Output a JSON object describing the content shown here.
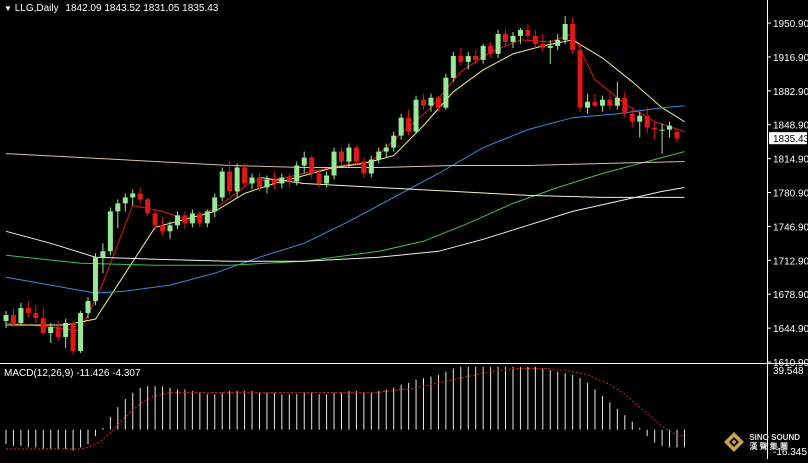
{
  "header": {
    "symbol_menu_glyph": "▼",
    "symbol": "LLG,Daily",
    "ohlc": "1842.09 1843.52 1831.05 1835.43"
  },
  "macd": {
    "label": "MACD(12,26,9) -11.426 -4.307",
    "axis_top": "39.548",
    "axis_bottom": "-16.345"
  },
  "price_axis": {
    "ticks": [
      "1950.90",
      "1916.90",
      "1882.90",
      "1848.90",
      "1814.90",
      "1780.90",
      "1746.90",
      "1712.90",
      "1678.90",
      "1644.90",
      "1610.90"
    ],
    "current_price": "1835.43"
  },
  "logo": {
    "line1": "SINO SOUND",
    "line2": "漢 聲 集 團",
    "icon": "sinosound-logo-icon"
  },
  "colors": {
    "background": "#000000",
    "bull_candle": "#98e898",
    "bear_candle": "#e01818",
    "ma_red": "#e01818",
    "ma_yellow": "#f0f080",
    "ma_blue": "#2f90e0",
    "ma_green": "#3cc04c",
    "ma_white": "#f0f0f0",
    "ma_tan": "#d8c0a0",
    "macd_hist": "#e8e8e8",
    "macd_signal": "#e02020",
    "axis_text": "#ffffff"
  },
  "chart_data": {
    "type": "candlestick",
    "ylim": [
      1610.9,
      1960.0
    ],
    "y_ticks": [
      1950.9,
      1916.9,
      1882.9,
      1848.9,
      1814.9,
      1780.9,
      1746.9,
      1712.9,
      1678.9,
      1644.9,
      1610.9
    ],
    "last_close": 1835.43,
    "candles": [
      [
        1652,
        1662,
        1645,
        1658
      ],
      [
        1658,
        1664,
        1646,
        1650
      ],
      [
        1650,
        1670,
        1648,
        1665
      ],
      [
        1665,
        1672,
        1656,
        1660
      ],
      [
        1660,
        1668,
        1650,
        1655
      ],
      [
        1655,
        1666,
        1638,
        1640
      ],
      [
        1640,
        1650,
        1630,
        1646
      ],
      [
        1646,
        1652,
        1632,
        1636
      ],
      [
        1636,
        1654,
        1625,
        1650
      ],
      [
        1650,
        1652,
        1618,
        1622
      ],
      [
        1622,
        1662,
        1620,
        1660
      ],
      [
        1660,
        1676,
        1655,
        1672
      ],
      [
        1672,
        1720,
        1668,
        1716
      ],
      [
        1716,
        1730,
        1700,
        1722
      ],
      [
        1722,
        1766,
        1718,
        1762
      ],
      [
        1762,
        1774,
        1745,
        1770
      ],
      [
        1770,
        1780,
        1762,
        1776
      ],
      [
        1776,
        1784,
        1768,
        1780
      ],
      [
        1780,
        1786,
        1770,
        1774
      ],
      [
        1774,
        1776,
        1757,
        1760
      ],
      [
        1760,
        1764,
        1744,
        1748
      ],
      [
        1748,
        1756,
        1738,
        1742
      ],
      [
        1742,
        1752,
        1734,
        1748
      ],
      [
        1748,
        1762,
        1744,
        1758
      ],
      [
        1758,
        1762,
        1744,
        1750
      ],
      [
        1750,
        1764,
        1746,
        1760
      ],
      [
        1760,
        1762,
        1746,
        1750
      ],
      [
        1750,
        1764,
        1746,
        1762
      ],
      [
        1762,
        1780,
        1756,
        1776
      ],
      [
        1776,
        1806,
        1772,
        1802
      ],
      [
        1802,
        1812,
        1778,
        1782
      ],
      [
        1782,
        1810,
        1776,
        1806
      ],
      [
        1806,
        1810,
        1786,
        1790
      ],
      [
        1790,
        1800,
        1784,
        1796
      ],
      [
        1796,
        1800,
        1782,
        1786
      ],
      [
        1786,
        1798,
        1780,
        1794
      ],
      [
        1794,
        1802,
        1784,
        1790
      ],
      [
        1790,
        1800,
        1785,
        1796
      ],
      [
        1796,
        1800,
        1786,
        1792
      ],
      [
        1792,
        1812,
        1788,
        1808
      ],
      [
        1808,
        1822,
        1800,
        1816
      ],
      [
        1816,
        1818,
        1795,
        1800
      ],
      [
        1800,
        1804,
        1786,
        1790
      ],
      [
        1790,
        1802,
        1786,
        1798
      ],
      [
        1798,
        1826,
        1794,
        1822
      ],
      [
        1822,
        1826,
        1808,
        1812
      ],
      [
        1812,
        1830,
        1806,
        1826
      ],
      [
        1826,
        1828,
        1808,
        1812
      ],
      [
        1812,
        1816,
        1796,
        1800
      ],
      [
        1800,
        1818,
        1796,
        1814
      ],
      [
        1814,
        1826,
        1810,
        1822
      ],
      [
        1822,
        1830,
        1816,
        1826
      ],
      [
        1826,
        1842,
        1822,
        1838
      ],
      [
        1838,
        1860,
        1834,
        1856
      ],
      [
        1856,
        1864,
        1838,
        1842
      ],
      [
        1842,
        1878,
        1840,
        1874
      ],
      [
        1874,
        1880,
        1864,
        1868
      ],
      [
        1868,
        1880,
        1862,
        1876
      ],
      [
        1876,
        1878,
        1862,
        1866
      ],
      [
        1866,
        1900,
        1864,
        1896
      ],
      [
        1896,
        1922,
        1892,
        1918
      ],
      [
        1918,
        1926,
        1908,
        1912
      ],
      [
        1912,
        1922,
        1904,
        1918
      ],
      [
        1918,
        1924,
        1910,
        1914
      ],
      [
        1914,
        1930,
        1910,
        1928
      ],
      [
        1928,
        1932,
        1916,
        1920
      ],
      [
        1920,
        1944,
        1916,
        1940
      ],
      [
        1940,
        1944,
        1928,
        1932
      ],
      [
        1932,
        1942,
        1926,
        1938
      ],
      [
        1938,
        1946,
        1930,
        1944
      ],
      [
        1944,
        1950,
        1934,
        1938
      ],
      [
        1938,
        1944,
        1926,
        1930
      ],
      [
        1930,
        1940,
        1922,
        1926
      ],
      [
        1926,
        1934,
        1910,
        1928
      ],
      [
        1928,
        1940,
        1924,
        1934
      ],
      [
        1934,
        1958,
        1930,
        1950
      ],
      [
        1950,
        1956,
        1920,
        1924
      ],
      [
        1924,
        1930,
        1862,
        1866
      ],
      [
        1866,
        1880,
        1860,
        1872
      ],
      [
        1872,
        1880,
        1866,
        1868
      ],
      [
        1868,
        1878,
        1862,
        1874
      ],
      [
        1874,
        1880,
        1864,
        1868
      ],
      [
        1868,
        1892,
        1864,
        1876
      ],
      [
        1876,
        1882,
        1856,
        1860
      ],
      [
        1860,
        1866,
        1846,
        1852
      ],
      [
        1852,
        1862,
        1836,
        1858
      ],
      [
        1858,
        1866,
        1840,
        1846
      ],
      [
        1846,
        1852,
        1834,
        1844
      ],
      [
        1844,
        1850,
        1820,
        1844
      ],
      [
        1844,
        1852,
        1836,
        1848
      ],
      [
        1842,
        1844,
        1831,
        1835
      ]
    ],
    "series": [
      {
        "name": "",
        "color": "#e01818",
        "values": [
          [
            0,
            1650
          ],
          [
            6,
            1646
          ],
          [
            10,
            1642
          ],
          [
            13,
            1690
          ],
          [
            17,
            1768
          ],
          [
            21,
            1762
          ],
          [
            25,
            1752
          ],
          [
            29,
            1770
          ],
          [
            33,
            1792
          ],
          [
            37,
            1795
          ],
          [
            41,
            1802
          ],
          [
            45,
            1808
          ],
          [
            49,
            1812
          ],
          [
            53,
            1840
          ],
          [
            57,
            1866
          ],
          [
            61,
            1902
          ],
          [
            65,
            1922
          ],
          [
            69,
            1934
          ],
          [
            73,
            1932
          ],
          [
            76,
            1940
          ],
          [
            79,
            1894
          ],
          [
            83,
            1870
          ],
          [
            87,
            1852
          ],
          [
            91,
            1842
          ]
        ]
      },
      {
        "name": "",
        "color": "#f0f080",
        "values": [
          [
            0,
            1648
          ],
          [
            8,
            1648
          ],
          [
            12,
            1654
          ],
          [
            16,
            1700
          ],
          [
            20,
            1746
          ],
          [
            24,
            1754
          ],
          [
            28,
            1762
          ],
          [
            32,
            1780
          ],
          [
            36,
            1790
          ],
          [
            40,
            1798
          ],
          [
            44,
            1806
          ],
          [
            48,
            1810
          ],
          [
            52,
            1818
          ],
          [
            56,
            1848
          ],
          [
            60,
            1882
          ],
          [
            64,
            1904
          ],
          [
            68,
            1920
          ],
          [
            72,
            1928
          ],
          [
            76,
            1934
          ],
          [
            80,
            1916
          ],
          [
            84,
            1892
          ],
          [
            88,
            1866
          ],
          [
            91,
            1852
          ]
        ]
      },
      {
        "name": "",
        "color": "#2f90e0",
        "values": [
          [
            0,
            1696
          ],
          [
            6,
            1688
          ],
          [
            12,
            1680
          ],
          [
            16,
            1682
          ],
          [
            22,
            1688
          ],
          [
            28,
            1700
          ],
          [
            34,
            1716
          ],
          [
            40,
            1730
          ],
          [
            46,
            1752
          ],
          [
            52,
            1776
          ],
          [
            58,
            1800
          ],
          [
            64,
            1826
          ],
          [
            70,
            1844
          ],
          [
            76,
            1856
          ],
          [
            82,
            1860
          ],
          [
            88,
            1866
          ],
          [
            91,
            1868
          ]
        ]
      },
      {
        "name": "",
        "color": "#3cc04c",
        "values": [
          [
            0,
            1718
          ],
          [
            10,
            1710
          ],
          [
            20,
            1708
          ],
          [
            30,
            1708
          ],
          [
            40,
            1712
          ],
          [
            50,
            1722
          ],
          [
            56,
            1732
          ],
          [
            62,
            1750
          ],
          [
            68,
            1770
          ],
          [
            74,
            1786
          ],
          [
            80,
            1800
          ],
          [
            86,
            1812
          ],
          [
            91,
            1822
          ]
        ]
      },
      {
        "name": "",
        "color": "#f0f0f0",
        "values": [
          [
            0,
            1742
          ],
          [
            6,
            1730
          ],
          [
            12,
            1716
          ],
          [
            20,
            1714
          ],
          [
            30,
            1712
          ],
          [
            40,
            1712
          ],
          [
            50,
            1716
          ],
          [
            58,
            1722
          ],
          [
            64,
            1734
          ],
          [
            70,
            1748
          ],
          [
            76,
            1762
          ],
          [
            82,
            1772
          ],
          [
            88,
            1782
          ],
          [
            91,
            1786
          ]
        ]
      },
      {
        "name": "",
        "color": "#d8c0a0",
        "values": [
          [
            0,
            1820
          ],
          [
            10,
            1816
          ],
          [
            20,
            1812
          ],
          [
            30,
            1808
          ],
          [
            40,
            1806
          ],
          [
            50,
            1806
          ],
          [
            60,
            1808
          ],
          [
            70,
            1808
          ],
          [
            80,
            1810
          ],
          [
            91,
            1812
          ]
        ]
      },
      {
        "name": "",
        "color": "#f0f0c8",
        "values": [
          [
            34,
            1796
          ],
          [
            40,
            1790
          ],
          [
            50,
            1786
          ],
          [
            60,
            1782
          ],
          [
            70,
            1778
          ],
          [
            80,
            1776
          ],
          [
            91,
            1776
          ]
        ]
      }
    ],
    "macd": {
      "ylim": [
        -16.345,
        39.548
      ],
      "histogram": [
        -9,
        -10,
        -10,
        -11,
        -11,
        -12,
        -12,
        -12,
        -12,
        -13,
        -11,
        -9,
        -4,
        1,
        8,
        14,
        19,
        23,
        26,
        27,
        27,
        27,
        26,
        25,
        25,
        24,
        23,
        22,
        22,
        23,
        24,
        24,
        24,
        24,
        23,
        23,
        23,
        22,
        22,
        22,
        23,
        23,
        22,
        22,
        23,
        23,
        24,
        24,
        23,
        23,
        24,
        25,
        26,
        28,
        29,
        31,
        32,
        33,
        34,
        36,
        38,
        39,
        39,
        39,
        39,
        39,
        39,
        39,
        39,
        39,
        39,
        39,
        38,
        37,
        36,
        35,
        34,
        32,
        29,
        25,
        21,
        17,
        13,
        9,
        5,
        1,
        -4,
        -8,
        -10,
        -11,
        -11,
        -11
      ],
      "signal": [
        -12,
        -12,
        -12,
        -12,
        -12,
        -12,
        -12,
        -12,
        -12,
        -12,
        -12,
        -11,
        -9,
        -6,
        -2,
        3,
        8,
        12,
        16,
        19,
        21,
        22,
        23,
        23,
        23,
        23,
        23,
        23,
        23,
        23,
        23,
        23,
        23,
        23,
        23,
        23,
        23,
        23,
        23,
        23,
        23,
        23,
        23,
        23,
        23,
        23,
        23,
        23,
        23,
        23,
        23,
        24,
        24,
        25,
        25,
        26,
        27,
        28,
        29,
        30,
        31,
        32,
        33,
        34,
        35,
        36,
        37,
        37,
        38,
        38,
        38,
        38,
        38,
        38,
        37,
        37,
        36,
        35,
        34,
        32,
        30,
        28,
        25,
        22,
        18,
        14,
        10,
        6,
        2,
        -1,
        -3,
        -4
      ]
    }
  }
}
